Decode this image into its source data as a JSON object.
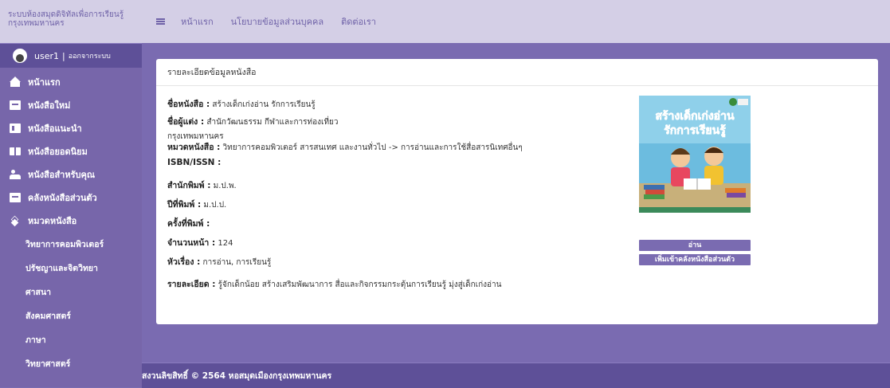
{
  "brand": {
    "title": "ระบบห้องสมุดดิจิทัลเพื่อการเรียนรู้ กรุงเทพมหานคร"
  },
  "user": {
    "name": "user1",
    "separator": "|",
    "logout": "ออกจากระบบ"
  },
  "menu": {
    "home": "หน้าแรก",
    "new_books": "หนังสือใหม่",
    "recommended": "หนังสือแนะนำ",
    "popular": "หนังสือยอดนิยม",
    "for_you": "หนังสือสำหรับคุณ",
    "shelf": "คลังหนังสือส่วนตัว",
    "categories": "หมวดหนังสือ",
    "sub": [
      "วิทยาการคอมพิวเตอร์",
      "ปรัชญาและจิตวิทยา",
      "ศาสนา",
      "สังคมศาสตร์",
      "ภาษา",
      "วิทยาศาสตร์"
    ]
  },
  "topnav": {
    "home": "หน้าแรก",
    "privacy": "นโยบายข้อมูลส่วนบุคคล",
    "contact": "ติดต่อเรา"
  },
  "card": {
    "header": "รายละเอียดข้อมูลหนังสือ"
  },
  "book": {
    "title_label": "ชื่อหนังสือ :",
    "title": "สร้างเด็กเก่งอ่าน รักการเรียนรู้",
    "author_label": "ชื่อผู้แต่ง :",
    "author": "สำนักวัฒนธรรม กีฬาและการท่องเที่ยว",
    "author_extra": "กรุงเทพมหานคร",
    "category_label": "หมวดหนังสือ :",
    "category": "วิทยาการคอมพิวเตอร์ สารสนเทศ และงานทั่วไป -> การอ่านและการใช้สื่อสารนิเทศอื่นๆ",
    "isbn_label": "ISBN/ISSN :",
    "isbn": "",
    "publisher_label": "สำนักพิมพ์ :",
    "publisher": "ม.ป.พ.",
    "year_label": "ปีที่พิมพ์ :",
    "year": "ม.ป.ป.",
    "edition_label": "ครั้งที่พิมพ์ :",
    "edition": "",
    "pages_label": "จำนวนหน้า :",
    "pages": "124",
    "subject_label": "หัวเรื่อง :",
    "subject": "การอ่าน, การเรียนรู้",
    "detail_label": "รายละเอียด :",
    "detail": "รู้จักเด็กน้อย สร้างเสริมพัฒนาการ สื่อและกิจกรรมกระตุ้นการเรียนรู้ มุ่งสู่เด็กเก่งอ่าน"
  },
  "cover": {
    "title_line1": "สร้างเด็กเก่งอ่าน",
    "title_line2": "รักการเรียนรู้"
  },
  "buttons": {
    "read": "อ่าน",
    "add_shelf": "เพิ่มเข้าคลังหนังสือส่วนตัว"
  },
  "footer": {
    "text": "สงวนลิขสิทธิ์ © 2564 หอสมุดเมืองกรุงเทพมหานคร"
  },
  "colors": {
    "accent": "#7a6bb1",
    "topbar": "#d4cfe6",
    "sidebar": "#7766aa"
  }
}
